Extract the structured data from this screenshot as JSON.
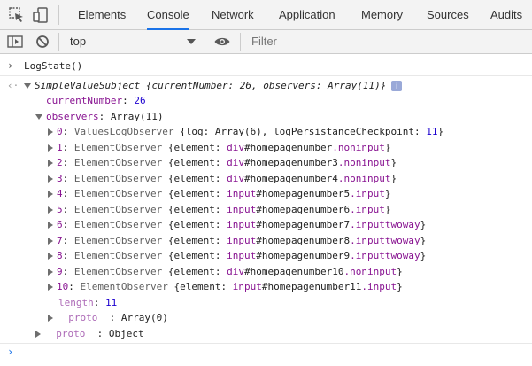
{
  "tabs": [
    "Elements",
    "Console",
    "Network",
    "Application",
    "Memory",
    "Sources",
    "Audits"
  ],
  "toolbar": {
    "context": "top",
    "filter_placeholder": "Filter"
  },
  "console": {
    "command": "LogState()",
    "result_head": {
      "name": "SimpleValueSubject",
      "body": "{currentNumber: 26, observers: Array(11)}"
    },
    "current_number": {
      "key": "currentNumber",
      "value": "26"
    },
    "observers_header": {
      "key": "observers",
      "value": "Array(11)"
    },
    "observers": [
      {
        "index": "0",
        "type": "ValuesLogObserver",
        "open": "{log: Array(6), logPersistanceCheckpoint: ",
        "num": "11",
        "close": "}"
      },
      {
        "index": "1",
        "type": "ElementObserver",
        "tag": "div",
        "id": "#homepagenumber",
        "cls": ".noninput"
      },
      {
        "index": "2",
        "type": "ElementObserver",
        "tag": "div",
        "id": "#homepagenumber3",
        "cls": ".noninput"
      },
      {
        "index": "3",
        "type": "ElementObserver",
        "tag": "div",
        "id": "#homepagenumber4",
        "cls": ".noninput"
      },
      {
        "index": "4",
        "type": "ElementObserver",
        "tag": "input",
        "id": "#homepagenumber5",
        "cls": ".input"
      },
      {
        "index": "5",
        "type": "ElementObserver",
        "tag": "input",
        "id": "#homepagenumber6",
        "cls": ".input"
      },
      {
        "index": "6",
        "type": "ElementObserver",
        "tag": "input",
        "id": "#homepagenumber7",
        "cls": ".inputtwoway"
      },
      {
        "index": "7",
        "type": "ElementObserver",
        "tag": "input",
        "id": "#homepagenumber8",
        "cls": ".inputtwoway"
      },
      {
        "index": "8",
        "type": "ElementObserver",
        "tag": "input",
        "id": "#homepagenumber9",
        "cls": ".inputtwoway"
      },
      {
        "index": "9",
        "type": "ElementObserver",
        "tag": "div",
        "id": "#homepagenumber10",
        "cls": ".noninput"
      },
      {
        "index": "10",
        "type": "ElementObserver",
        "tag": "input",
        "id": "#homepagenumber11",
        "cls": ".input"
      }
    ],
    "length": {
      "key": "length",
      "value": "11"
    },
    "proto_inner": {
      "key": "__proto__",
      "value": "Array(0)"
    },
    "proto_outer": {
      "key": "__proto__",
      "value": "Object"
    }
  },
  "icons": [
    "inspect-icon",
    "device-toggle-icon",
    "console-sidebar-icon",
    "clear-console-icon",
    "eye-icon",
    "dropdown-arrow-icon",
    "expand-triangle-icon",
    "collapse-triangle-icon",
    "info-icon"
  ],
  "colors": {
    "key": "#881391",
    "number": "#1c00cf",
    "type": "#5f5f5f",
    "active_tab_underline": "#1a73e8"
  }
}
